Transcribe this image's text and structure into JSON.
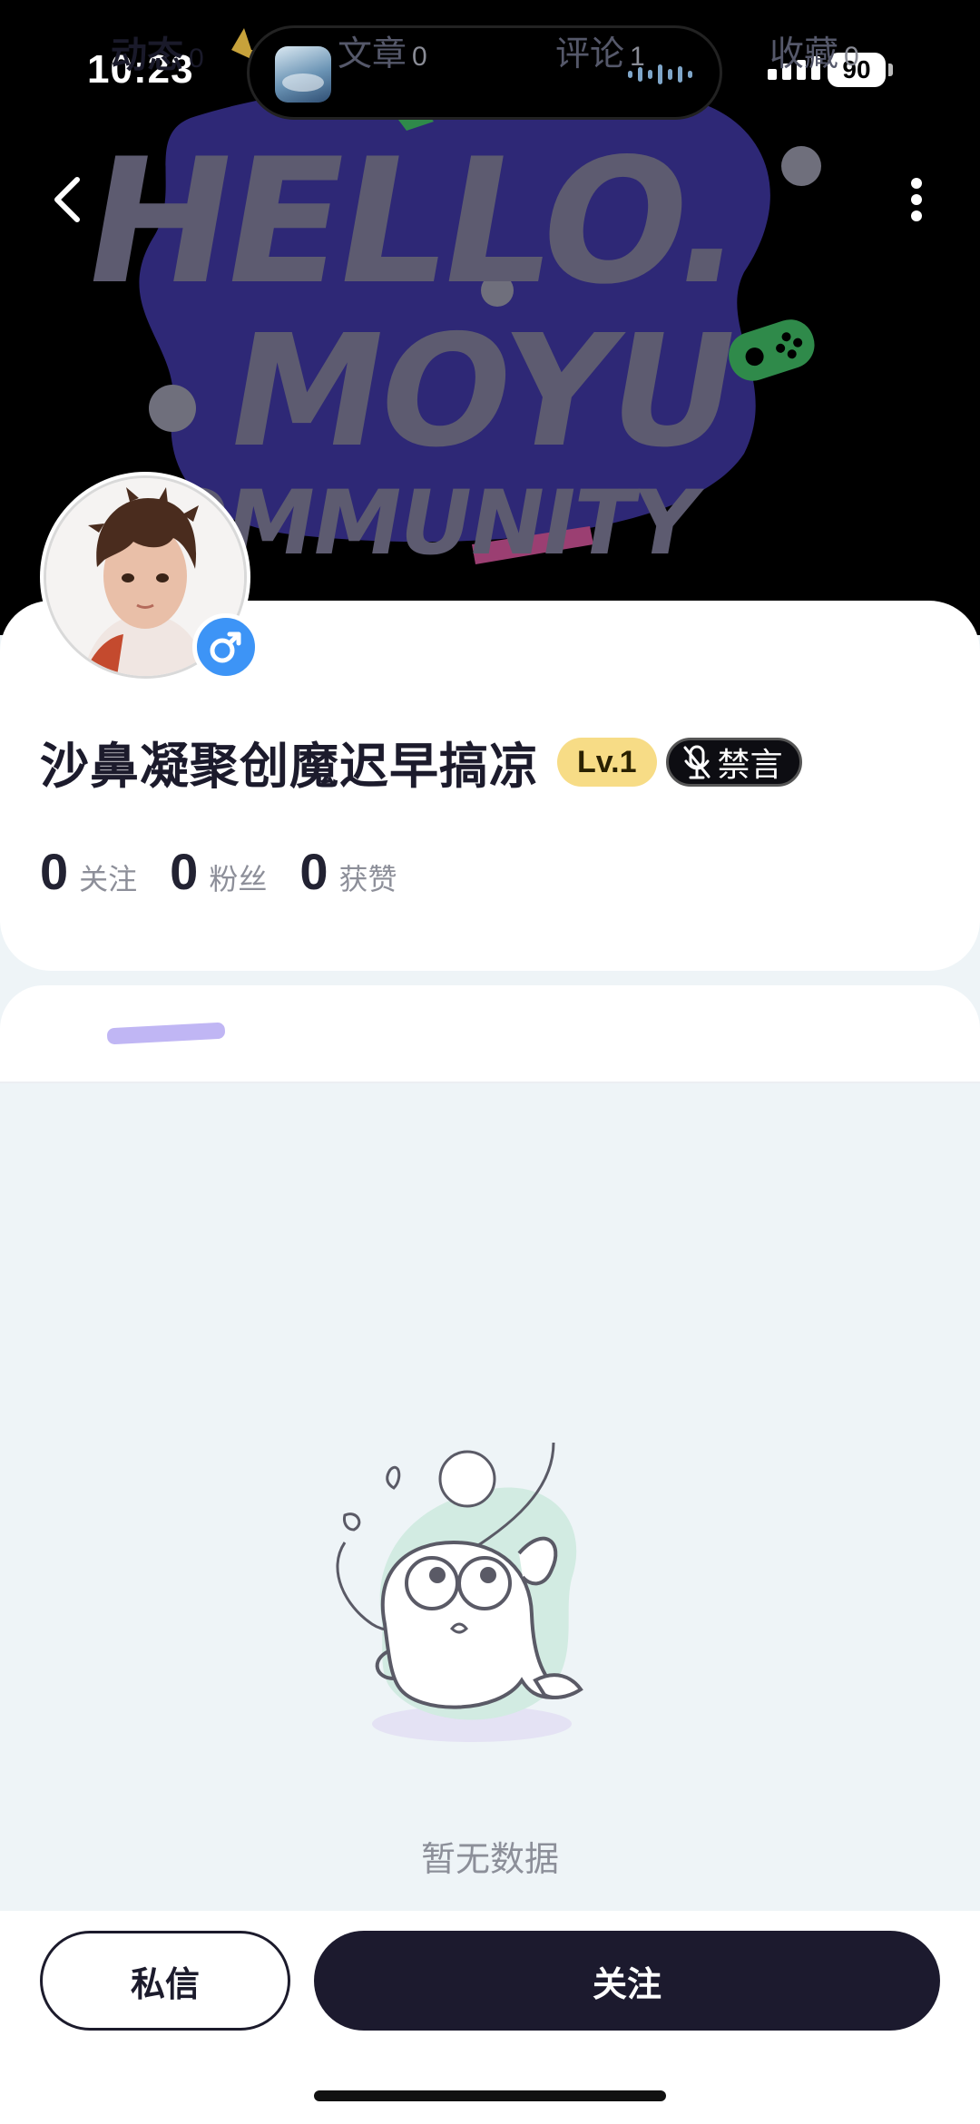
{
  "status_bar": {
    "time": "10:23",
    "battery": "90"
  },
  "banner": {
    "line1": "HELLO.",
    "line2": "MOYU",
    "line3": "COMMUNITY"
  },
  "profile": {
    "nickname": "沙鼻凝聚创魔迟早搞凉",
    "level": "Lv.1",
    "mute_label": "禁言",
    "gender": "male"
  },
  "stats": [
    {
      "value": "0",
      "label": "关注"
    },
    {
      "value": "0",
      "label": "粉丝"
    },
    {
      "value": "0",
      "label": "获赞"
    }
  ],
  "tabs": [
    {
      "label": "动态",
      "count": "0"
    },
    {
      "label": "文章",
      "count": "0"
    },
    {
      "label": "评论",
      "count": "1"
    },
    {
      "label": "收藏",
      "count": "0"
    }
  ],
  "empty_state": {
    "text": "暂无数据"
  },
  "actions": {
    "message_label": "私信",
    "follow_label": "关注"
  },
  "colors": {
    "accent_dark": "#1c1a2e",
    "level_bg": "#f7dc86",
    "gender_blue": "#3d94f6",
    "tab_highlight": "#b5a9f2"
  }
}
